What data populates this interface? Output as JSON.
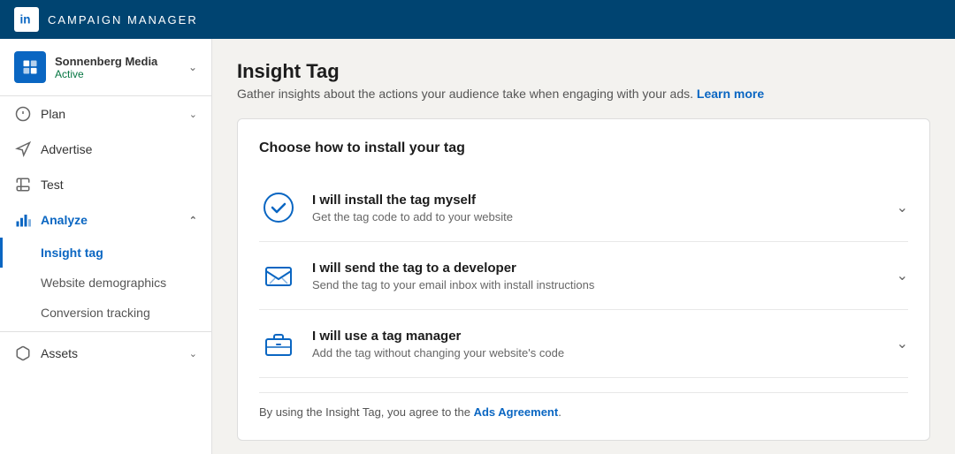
{
  "topNav": {
    "logo_letter": "in",
    "title": "CAMPAIGN MANAGER"
  },
  "sidebar": {
    "account": {
      "name": "Sonnenberg Media",
      "status": "Active"
    },
    "items": [
      {
        "id": "plan",
        "label": "Plan",
        "has_children": true
      },
      {
        "id": "advertise",
        "label": "Advertise",
        "has_children": false
      },
      {
        "id": "test",
        "label": "Test",
        "has_children": false
      },
      {
        "id": "analyze",
        "label": "Analyze",
        "has_children": true,
        "active": true
      }
    ],
    "analyze_subitems": [
      {
        "id": "insight-tag",
        "label": "Insight tag",
        "active": true
      },
      {
        "id": "website-demographics",
        "label": "Website demographics",
        "active": false
      },
      {
        "id": "conversion-tracking",
        "label": "Conversion tracking",
        "active": false
      }
    ],
    "bottom_items": [
      {
        "id": "assets",
        "label": "Assets",
        "has_children": true
      }
    ]
  },
  "main": {
    "page_title": "Insight Tag",
    "page_subtitle": "Gather insights about the actions your audience take when engaging with your ads.",
    "learn_more_label": "Learn more",
    "card_title": "Choose how to install your tag",
    "options": [
      {
        "id": "install-myself",
        "title": "I will install the tag myself",
        "desc": "Get the tag code to add to your website",
        "icon_type": "check-circle",
        "selected": true
      },
      {
        "id": "send-developer",
        "title": "I will send the tag to a developer",
        "desc": "Send the tag to your email inbox with install instructions",
        "icon_type": "email",
        "selected": false
      },
      {
        "id": "tag-manager",
        "title": "I will use a tag manager",
        "desc": "Add the tag without changing your website's code",
        "icon_type": "briefcase",
        "selected": false
      }
    ],
    "footer_text": "By using the Insight Tag, you agree to the ",
    "footer_link": "Ads Agreement",
    "footer_end": "."
  }
}
